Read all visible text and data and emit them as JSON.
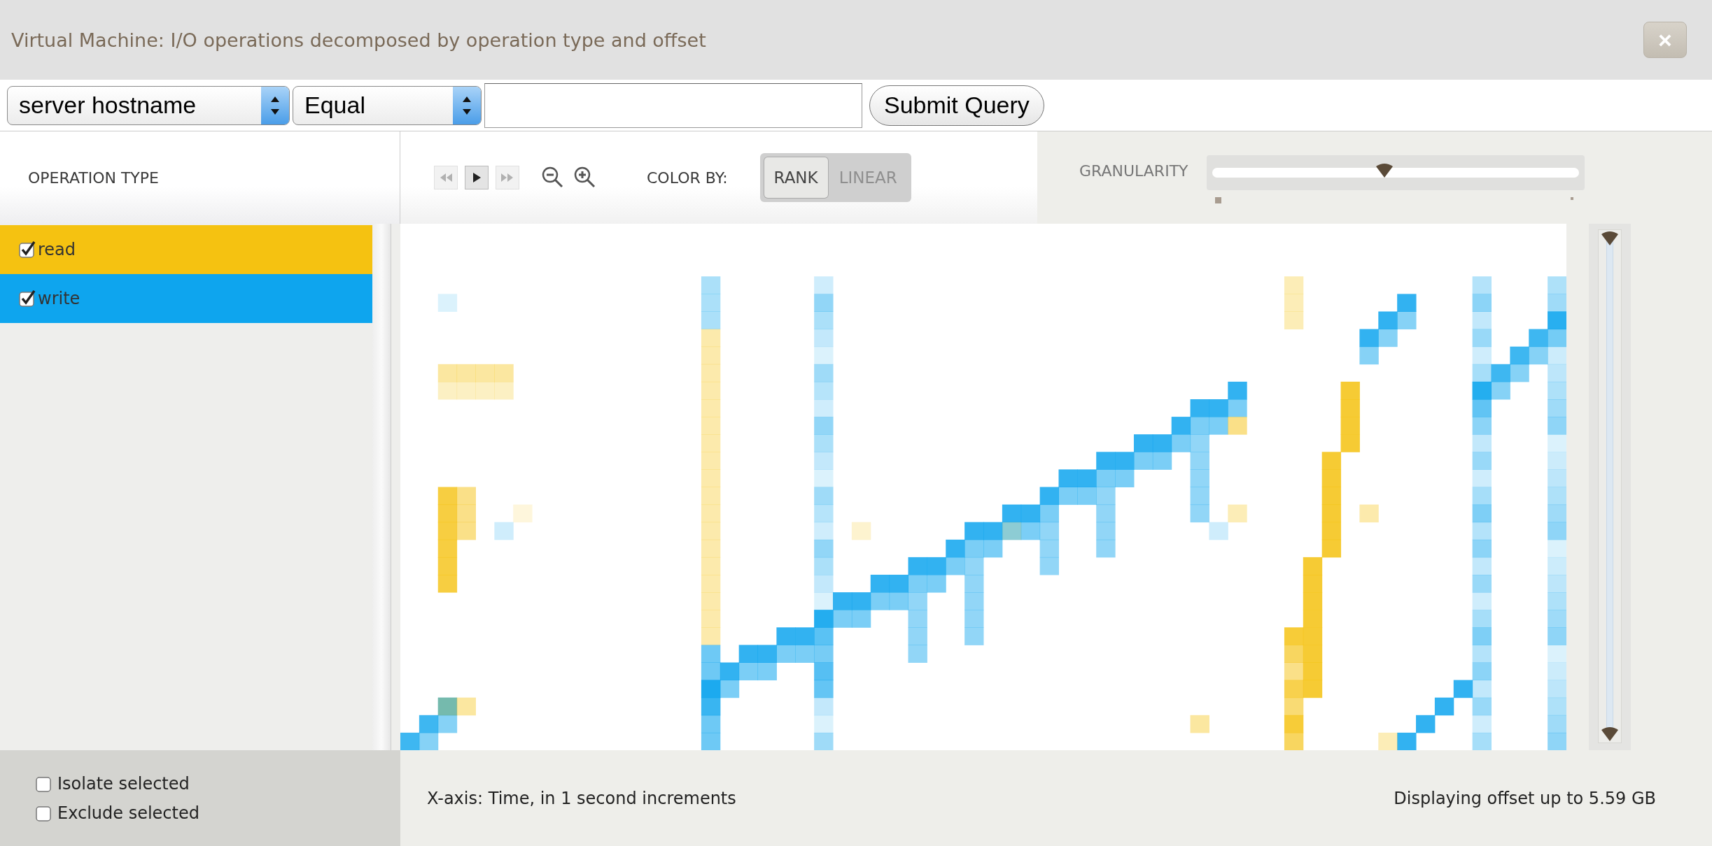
{
  "window": {
    "title": "Virtual Machine: I/O operations decomposed by operation type and offset",
    "close_label": "×"
  },
  "query": {
    "field_select": "server hostname",
    "operator_select": "Equal",
    "submit": "Submit Query"
  },
  "operation_panel": {
    "header": "OPERATION TYPE",
    "items": [
      {
        "label": "read",
        "checked": true,
        "color": "#f5c211"
      },
      {
        "label": "write",
        "checked": true,
        "color": "#0ea5ee"
      }
    ]
  },
  "toolbar": {
    "rewind_disabled": true,
    "forward_disabled": true,
    "color_by_label": "COLOR BY:",
    "color_modes": [
      {
        "label": "RANK",
        "selected": true
      },
      {
        "label": "LINEAR",
        "selected": false
      }
    ],
    "granularity_label": "GRANULARITY",
    "granularity": {
      "level": 0.47
    },
    "offset_range": {
      "level": 1
    }
  },
  "filters": [
    {
      "label": "Isolate selected",
      "checked": false
    },
    {
      "label": "Exclude selected",
      "checked": false
    }
  ],
  "footer": {
    "x_axis_note": "X-axis: Time, in 1 second increments",
    "offset_note": "Displaying offset up to 5.59 GB"
  }
}
